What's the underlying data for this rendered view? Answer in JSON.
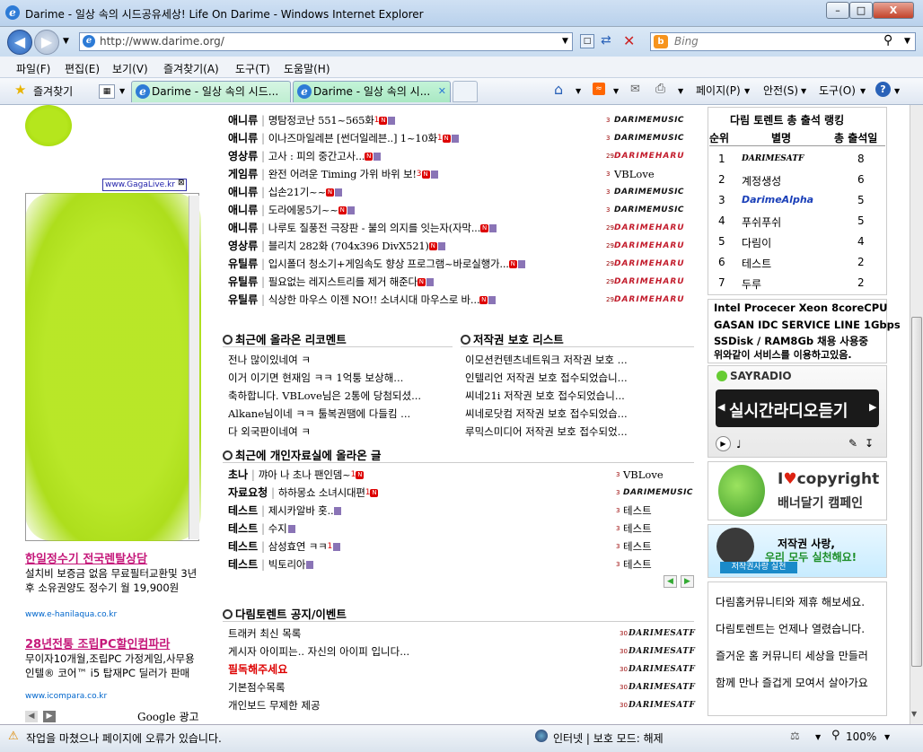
{
  "window": {
    "title": "Darime - 일상 속의 시드공유세상! Life On Darime - Windows Internet Explorer",
    "min": "–",
    "max": "□",
    "close": "X"
  },
  "address": {
    "url": "http://www.darime.org/",
    "search_placeholder": "Bing"
  },
  "menu": [
    "파일(F)",
    "편집(E)",
    "보기(V)",
    "즐겨찾기(A)",
    "도구(T)",
    "도움말(H)"
  ],
  "favorites": {
    "label": "즐겨찾기",
    "tabs": [
      "Darime - 일상 속의 시드...",
      "Darime - 일상 속의 시..."
    ],
    "commands": [
      "페이지(P)",
      "안전(S)",
      "도구(O)"
    ]
  },
  "colors": {
    "accent": "#2d7bd6",
    "hot": "#dd0000",
    "ad": "#c5187a"
  },
  "top_list": [
    {
      "cat": "애니류",
      "title": "명탐정코난 551~565화",
      "new": "1",
      "src": "DARIMEMUSIC",
      "lvl": "3"
    },
    {
      "cat": "애니류",
      "title": "이나즈마일레븐 [썬더일레븐..] 1~10화",
      "new": "1",
      "src": "DARIMEMUSIC",
      "lvl": "3"
    },
    {
      "cat": "영상류",
      "title": "고사 : 피의 중간고사...",
      "new": "",
      "src": "DARIMEHARU",
      "lvl": "29"
    },
    {
      "cat": "게임류",
      "title": "완전 어려운 Timing 가위 바위 보!",
      "new": "3",
      "src": "VBLove",
      "lvl": "3"
    },
    {
      "cat": "애니류",
      "title": "십손21기~~",
      "new": "",
      "src": "DARIMEMUSIC",
      "lvl": "3"
    },
    {
      "cat": "애니류",
      "title": "도라에몽5기~~",
      "new": "",
      "src": "DARIMEMUSIC",
      "lvl": "3"
    },
    {
      "cat": "애니류",
      "title": "나루토 질풍전 극장판 - 불의 의지를 잇는자(자막...",
      "new": "",
      "src": "DARIMEHARU",
      "lvl": "29"
    },
    {
      "cat": "영상류",
      "title": "블리치 282화 (704x396 DivX521)",
      "new": "",
      "src": "DARIMEHARU",
      "lvl": "29"
    },
    {
      "cat": "유틸류",
      "title": "입시폴더 청소기+게임속도 향상 프로그램~바로실행가...",
      "new": "",
      "src": "DARIMEHARU",
      "lvl": "29"
    },
    {
      "cat": "유틸류",
      "title": "필요없는 레지스트리를 제거 해준다",
      "new": "",
      "src": "DARIMEHARU",
      "lvl": "29"
    },
    {
      "cat": "유틸류",
      "title": "식상한 마우스 이젠 NO!! 소녀시대 마우스로 바...",
      "new": "",
      "src": "DARIMEHARU",
      "lvl": "29"
    }
  ],
  "recent_comments": {
    "title": "최근에 올라온 리코멘트",
    "items": [
      "전나 많이있네여 ㅋ",
      "이거 이기면 현재임 ㅋㅋ 1억퉁 보상해...",
      "축하합니다. VBLove님은 2통에 당첨되셨...",
      "Alkane님이네 ㅋㅋ 툴복권땜에 다들킴 ...",
      "다 외국판이네여 ㅋ"
    ]
  },
  "copyright_list": {
    "title": "저작권 보호 리스트",
    "items": [
      "이모션컨텐츠네트워크 저작권 보호 ...",
      "인텔리언 저작권 보호 접수되었습니...",
      "씨네21i 저작권 보호 접수되었습니...",
      "씨네로닷컴 저작권 보호 접수되었습...",
      "루믹스미디어 저작권 보호 접수되었..."
    ]
  },
  "personal": {
    "title": "최근에 개인자료실에 올라온 글",
    "rows": [
      {
        "cat": "초나",
        "title": "꺄아 나 초나 팬인뎀~",
        "new": "1",
        "src": "VBLove",
        "lvl": "3"
      },
      {
        "cat": "자료요청",
        "title": "하하몽쇼 소녀시대편",
        "new": "1",
        "src": "DARIMEMUSIC",
        "lvl": "3"
      },
      {
        "cat": "테스트",
        "title": "제시카알바 홋..",
        "new": "",
        "src": "테스트",
        "lvl": "3"
      },
      {
        "cat": "테스트",
        "title": "수지",
        "new": "",
        "src": "테스트",
        "lvl": "3"
      },
      {
        "cat": "테스트",
        "title": "삼성효연 ㅋㅋ",
        "new": "1",
        "src": "테스트",
        "lvl": "3"
      },
      {
        "cat": "테스트",
        "title": "빅토리아",
        "new": "",
        "src": "테스트",
        "lvl": "3"
      }
    ]
  },
  "notice": {
    "title": "다림토렌트 공지/이벤트",
    "items": [
      {
        "text": "트래커 최신 목록",
        "src": "DARIMESATF",
        "red": false
      },
      {
        "text": "게시자 아이피는.. 자신의 아이피 입니다...",
        "src": "DARIMESATF",
        "red": false
      },
      {
        "text": "필독해주세요",
        "src": "DARIMESATF",
        "red": true
      },
      {
        "text": "기본점수목록",
        "src": "DARIMESATF",
        "red": false
      },
      {
        "text": "개인보드 무제한 제공",
        "src": "DARIMESATF",
        "red": false
      }
    ]
  },
  "ranking": {
    "title": "다림 토렌트 총 출석 랭킹",
    "headers": [
      "순위",
      "별명",
      "총 출석일"
    ],
    "rows": [
      {
        "rank": "1",
        "name": "DARIMESATF",
        "days": "8"
      },
      {
        "rank": "2",
        "name": "계정생성",
        "days": "6"
      },
      {
        "rank": "3",
        "name": "DarimeAlpha",
        "days": "5"
      },
      {
        "rank": "4",
        "name": "푸쉬푸쉬",
        "days": "5"
      },
      {
        "rank": "5",
        "name": "다림이",
        "days": "4"
      },
      {
        "rank": "6",
        "name": "테스트",
        "days": "2"
      },
      {
        "rank": "7",
        "name": "두루",
        "days": "2"
      }
    ]
  },
  "server": {
    "line1": "Intel Procecer Xeon 8coreCPU",
    "line2": "GASAN IDC SERVICE LINE 1Gbps",
    "line3": "SSDisk / RAM8Gb 채용 사용중",
    "line4": "위와같이 서비스를 이용하고있음."
  },
  "radio": {
    "brand": "SAYRADIO",
    "label": "실시간라디오듣기"
  },
  "copyright_banner": {
    "line1": "I",
    "line1b": "copyright",
    "line2": "배너달기 캠페인"
  },
  "love_banner": {
    "line1": "저작권 사랑,",
    "line2": "우리 모두 실천해요!",
    "line3": "저작권사랑 실천"
  },
  "partner": [
    "다림홈커뮤니티와 제휴 해보세요.",
    "다림토렌트는 언제나 열렸습니다.",
    "즐거운 홈 커뮤니티 세상을 만들러",
    "함께 만나 즐겁게 모여서 살아가요"
  ],
  "left_ads": {
    "gagalive": "www.GagaLive.kr",
    "ad1_title": "한일정수기 전국렌탈상담",
    "ad1_body": "설치비 보증금 없음 무료필터교환및 3년후 소유권양도 정수기 월 19,900원",
    "ad1_url": "www.e-hanilaqua.co.kr",
    "ad2_title": "28년전통 조립PC할인컴파라",
    "ad2_body": "무이자10개월,조립PC 가정게임,사무용 인텔® 코어™ i5 탑재PC 딜러가 판매",
    "ad2_url": "www.icompara.co.kr",
    "google": "Google 광고"
  },
  "status": {
    "text": "작업을 마쳤으나 페이지에 오류가 있습니다.",
    "zone": "인터넷 | 보호 모드: 해제",
    "zoom": "100%"
  }
}
